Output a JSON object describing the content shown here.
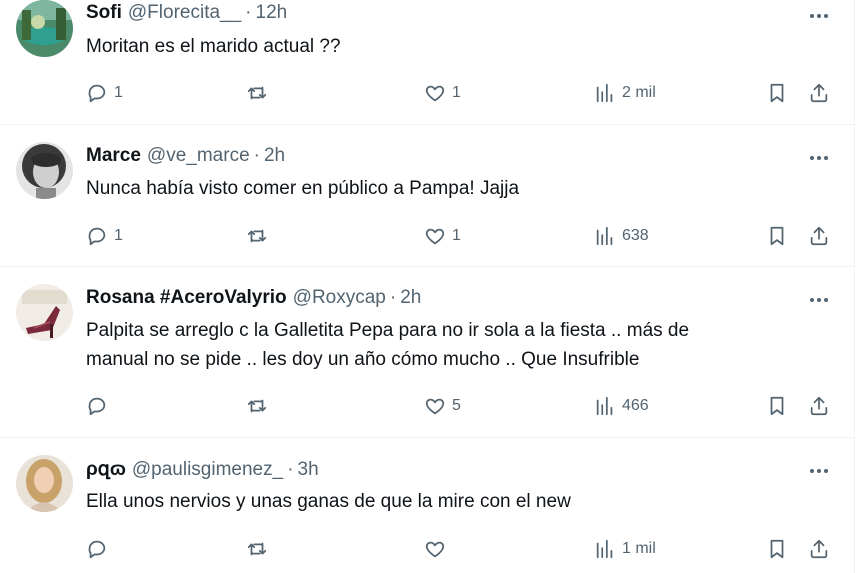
{
  "tweets": [
    {
      "name": "Sofi",
      "handle": "@Florecita__",
      "time": "12h",
      "text": [
        "Moritan es el marido actual ??"
      ],
      "replies": "1",
      "retweets": "",
      "likes": "1",
      "views": "2 mil",
      "avatar": "landscape-avatar"
    },
    {
      "name": "Marce",
      "handle": "@ve_marce",
      "time": "2h",
      "text": [
        "Nunca había visto comer en público a Pampa! Jajja"
      ],
      "replies": "1",
      "retweets": "",
      "likes": "1",
      "views": "638",
      "avatar": "woman-bw-avatar"
    },
    {
      "name": "Rosana #AceroValyrio",
      "handle": "@Roxycap",
      "time": "2h",
      "text": [
        "Palpita se arreglo c la Galletita Pepa para no ir sola a la fiesta .. más de",
        "manual no se pide .. les doy un año cómo mucho .. Que Insufrible"
      ],
      "replies": "",
      "retweets": "",
      "likes": "5",
      "views": "466",
      "avatar": "shoe-avatar"
    },
    {
      "name": "ρզɷ",
      "handle": "@paulisgimenez_",
      "time": "3h",
      "text": [
        "Ella unos nervios y unas ganas de que la mire con el new"
      ],
      "replies": "",
      "retweets": "",
      "likes": "",
      "views": "1 mil",
      "avatar": "blonde-woman-avatar"
    }
  ],
  "separator": "·",
  "colors": {
    "text": "#0f1419",
    "secondary": "#536471",
    "border": "#eff3f4"
  }
}
